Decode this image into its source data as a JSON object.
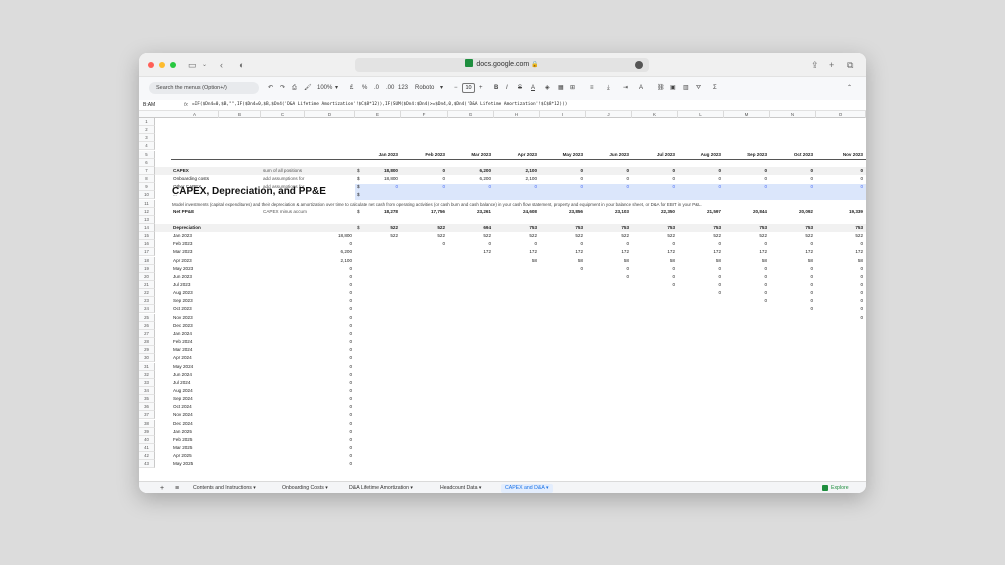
{
  "browser": {
    "url": "docs.google.com",
    "lock_icon": "lock-icon"
  },
  "toolbar": {
    "menu_search": "Search the menus (Option+/)",
    "zoom": "100%",
    "currency": "£",
    "percent": "%",
    "decimal_less": ".0",
    "decimal_more": ".00",
    "format_123": "123",
    "font": "Roboto",
    "font_size": "10",
    "bold": "B",
    "italic": "I",
    "strike": "S",
    "text_color": "A"
  },
  "formula_bar": {
    "name_box": "B:AM",
    "fx": "fx",
    "formula": "=IF($Dn4=0,$B,\"\",IF($Dn4=0,$B,$Dn4('D&A Lifetime Amortization'!$C$8*12)),IF(SUM($Dn4:$Dn4)>=$Dn4,0,$Dn4('D&A Lifetime Amortization'!$C$8*12)))"
  },
  "columns": [
    "A",
    "B",
    "C",
    "D",
    "E",
    "F",
    "G",
    "H",
    "I",
    "J",
    "K",
    "L",
    "M",
    "N",
    "O",
    "P"
  ],
  "rows": [
    "1",
    "2",
    "3",
    "4",
    "5",
    "6",
    "7",
    "8",
    "9",
    "10",
    "11",
    "12",
    "13",
    "14",
    "15",
    "16",
    "17",
    "18",
    "19",
    "20",
    "21",
    "22",
    "23",
    "24",
    "25",
    "26",
    "27",
    "28",
    "29",
    "30",
    "31",
    "32",
    "33",
    "34",
    "35",
    "36",
    "37",
    "38",
    "39",
    "40",
    "41",
    "42",
    "43"
  ],
  "sheet": {
    "title": "CAPEX, Depreciation, and PP&E",
    "subtitle": "Model investments (capital expenditures) and their depreciation & amortization over time to calculate net cash from operating activities (or cash burn and cash balance) in your cash flow statement, property and equipment in your balance sheet, or D&A for EBIT in your P&L.",
    "months": [
      "Jan 2023",
      "Feb 2023",
      "Mar 2023",
      "Apr 2023",
      "May 2023",
      "Jun 2023",
      "Jul 2023",
      "Aug 2023",
      "Sep 2023",
      "Oct 2023",
      "Nov 2023"
    ],
    "capex": {
      "label": "CAPEX",
      "note": "sum of all positions",
      "values": [
        "18,800",
        "0",
        "6,200",
        "2,100",
        "0",
        "0",
        "0",
        "0",
        "0",
        "0",
        "0"
      ]
    },
    "onboarding": {
      "label": "Onboarding costs",
      "note": "add assumptions for",
      "values": [
        "18,800",
        "0",
        "6,200",
        "2,100",
        "0",
        "0",
        "0",
        "0",
        "0",
        "0",
        "0"
      ]
    },
    "other_capex": {
      "label": "Other CAPEX",
      "note": "add assumptions for",
      "values": [
        "0",
        "0",
        "0",
        "0",
        "0",
        "0",
        "0",
        "0",
        "0",
        "0",
        "0"
      ]
    },
    "ellipsis": "...",
    "currency_symbol": "$",
    "net_ppe": {
      "label": "Net PP&E",
      "note": "CAPEX minus accum",
      "values": [
        "18,278",
        "17,756",
        "23,261",
        "24,608",
        "23,856",
        "23,103",
        "22,350",
        "21,597",
        "20,844",
        "20,092",
        "19,339"
      ]
    },
    "depreciation": {
      "label": "Depreciation",
      "values": [
        "522",
        "522",
        "694",
        "753",
        "753",
        "753",
        "753",
        "753",
        "753",
        "753",
        "753"
      ]
    },
    "schedule": [
      {
        "month": "Jan 2023",
        "amount": "18,800",
        "values": [
          "522",
          "522",
          "522",
          "522",
          "522",
          "522",
          "522",
          "522",
          "522",
          "522",
          "522"
        ]
      },
      {
        "month": "Feb 2023",
        "amount": "0",
        "values": [
          "",
          "0",
          "0",
          "0",
          "0",
          "0",
          "0",
          "0",
          "0",
          "0",
          "0"
        ]
      },
      {
        "month": "Mar 2023",
        "amount": "6,200",
        "values": [
          "",
          "",
          "172",
          "172",
          "172",
          "172",
          "172",
          "172",
          "172",
          "172",
          "172"
        ]
      },
      {
        "month": "Apr 2023",
        "amount": "2,100",
        "values": [
          "",
          "",
          "",
          "58",
          "58",
          "58",
          "58",
          "58",
          "58",
          "58",
          "58"
        ]
      },
      {
        "month": "May 2023",
        "amount": "0",
        "values": [
          "",
          "",
          "",
          "",
          "0",
          "0",
          "0",
          "0",
          "0",
          "0",
          "0"
        ]
      },
      {
        "month": "Jun 2023",
        "amount": "0",
        "values": [
          "",
          "",
          "",
          "",
          "",
          "0",
          "0",
          "0",
          "0",
          "0",
          "0"
        ]
      },
      {
        "month": "Jul 2023",
        "amount": "0",
        "values": [
          "",
          "",
          "",
          "",
          "",
          "",
          "0",
          "0",
          "0",
          "0",
          "0"
        ]
      },
      {
        "month": "Aug 2023",
        "amount": "0",
        "values": [
          "",
          "",
          "",
          "",
          "",
          "",
          "",
          "0",
          "0",
          "0",
          "0"
        ]
      },
      {
        "month": "Sep 2023",
        "amount": "0",
        "values": [
          "",
          "",
          "",
          "",
          "",
          "",
          "",
          "",
          "0",
          "0",
          "0"
        ]
      },
      {
        "month": "Oct 2023",
        "amount": "0",
        "values": [
          "",
          "",
          "",
          "",
          "",
          "",
          "",
          "",
          "",
          "0",
          "0"
        ]
      },
      {
        "month": "Nov 2023",
        "amount": "0",
        "values": [
          "",
          "",
          "",
          "",
          "",
          "",
          "",
          "",
          "",
          "",
          "0"
        ]
      },
      {
        "month": "Dec 2023",
        "amount": "0",
        "values": []
      },
      {
        "month": "Jan 2024",
        "amount": "0",
        "values": []
      },
      {
        "month": "Feb 2024",
        "amount": "0",
        "values": []
      },
      {
        "month": "Mar 2024",
        "amount": "0",
        "values": []
      },
      {
        "month": "Apr 2024",
        "amount": "0",
        "values": []
      },
      {
        "month": "May 2024",
        "amount": "0",
        "values": []
      },
      {
        "month": "Jun 2024",
        "amount": "0",
        "values": []
      },
      {
        "month": "Jul 2024",
        "amount": "0",
        "values": []
      },
      {
        "month": "Aug 2024",
        "amount": "0",
        "values": []
      },
      {
        "month": "Sep 2024",
        "amount": "0",
        "values": []
      },
      {
        "month": "Oct 2024",
        "amount": "0",
        "values": []
      },
      {
        "month": "Nov 2024",
        "amount": "0",
        "values": []
      },
      {
        "month": "Dec 2024",
        "amount": "0",
        "values": []
      },
      {
        "month": "Jan 2025",
        "amount": "0",
        "values": []
      },
      {
        "month": "Feb 2025",
        "amount": "0",
        "values": []
      },
      {
        "month": "Mar 2025",
        "amount": "0",
        "values": []
      },
      {
        "month": "Apr 2025",
        "amount": "0",
        "values": []
      },
      {
        "month": "May 2025",
        "amount": "0",
        "values": []
      }
    ]
  },
  "tabs": {
    "add": "+",
    "list": "≡",
    "items": [
      "Contents and Instructions",
      "Onboarding Costs",
      "D&A Lifetime Amortization",
      "Headcount Data",
      "CAPEX and D&A"
    ],
    "active_index": 4,
    "explore": "Explore"
  },
  "colors": {
    "accent": "#1a73e8",
    "input_blue": "#4a6cf7",
    "highlight": "#dbe6fb"
  }
}
